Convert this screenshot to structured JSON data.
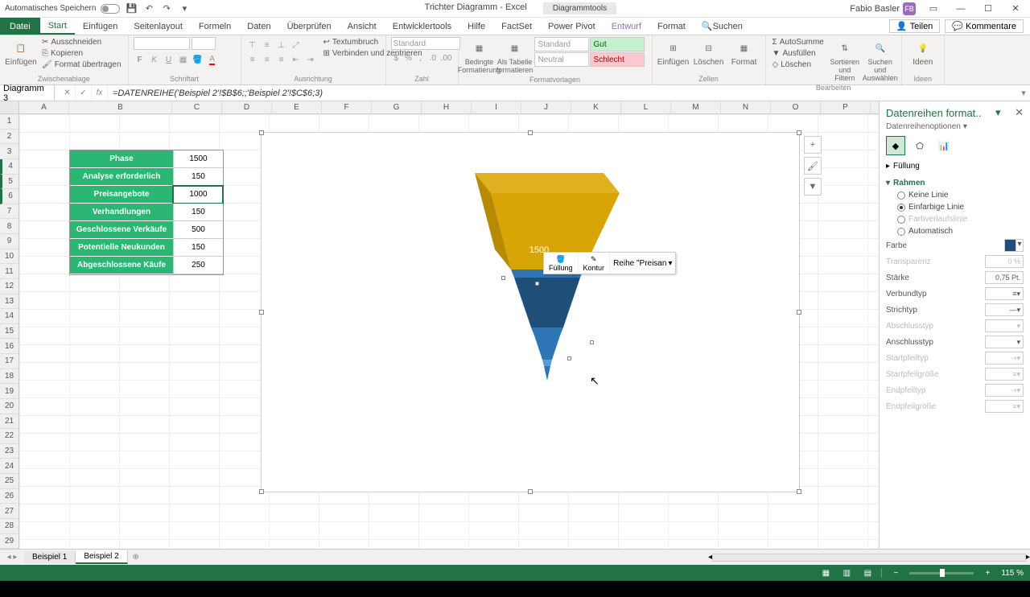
{
  "titlebar": {
    "autosave": "Automatisches Speichern",
    "center_title": "Trichter Diagramm  -  Excel",
    "tool_tab": "Diagrammtools",
    "user": "Fabio Basler",
    "user_initials": "FB"
  },
  "tabs": {
    "file": "Datei",
    "list": [
      "Start",
      "Einfügen",
      "Seitenlayout",
      "Formeln",
      "Daten",
      "Überprüfen",
      "Ansicht",
      "Entwicklertools",
      "Hilfe",
      "FactSet",
      "Power Pivot",
      "Entwurf",
      "Format"
    ],
    "search": "Suchen",
    "share": "Teilen",
    "comments": "Kommentare"
  },
  "ribbon": {
    "paste": "Einfügen",
    "cut": "Ausschneiden",
    "copy": "Kopieren",
    "format_painter": "Format übertragen",
    "clipboard": "Zwischenablage",
    "font_group": "Schriftart",
    "align_group": "Ausrichtung",
    "number_group": "Zahl",
    "wraptext": "Textumbruch",
    "merge": "Verbinden und zentrieren",
    "number_format": "Standard",
    "cond_format": "Bedingte Formatierung",
    "as_table": "Als Tabelle formatieren",
    "styles_group": "Formatvorlagen",
    "style_standard": "Standard",
    "style_good": "Gut",
    "style_neutral": "Neutral",
    "style_bad": "Schlecht",
    "insert": "Einfügen",
    "delete": "Löschen",
    "format": "Format",
    "cells_group": "Zellen",
    "autosum": "AutoSumme",
    "fill": "Ausfüllen",
    "clear": "Löschen",
    "sort": "Sortieren und Filtern",
    "find": "Suchen und Auswählen",
    "edit_group": "Bearbeiten",
    "ideas": "Ideen",
    "ideas_group": "Ideen"
  },
  "formula_bar": {
    "name": "Diagramm 3",
    "formula": "=DATENREIHE('Beispiel 2'!$B$6;;'Beispiel 2'!$C$6;3)"
  },
  "columns": [
    "A",
    "B",
    "C",
    "D",
    "E",
    "F",
    "G",
    "H",
    "I",
    "J",
    "K",
    "L",
    "M",
    "N",
    "O",
    "P"
  ],
  "rows": [
    "1",
    "2",
    "3",
    "4",
    "5",
    "6",
    "7",
    "8",
    "9",
    "10",
    "11",
    "12",
    "13",
    "14",
    "15",
    "16",
    "17",
    "18",
    "19",
    "20",
    "21",
    "22",
    "23",
    "24",
    "25",
    "26",
    "27",
    "28",
    "29"
  ],
  "table": {
    "header": "Phase",
    "header_val": "1500",
    "rows": [
      {
        "label": "Analyse erforderlich",
        "val": "150"
      },
      {
        "label": "Preisangebote",
        "val": "1000"
      },
      {
        "label": "Verhandlungen",
        "val": "150"
      },
      {
        "label": "Geschlossene Verkäufe",
        "val": "500"
      },
      {
        "label": "Potentielle Neukunden",
        "val": "150"
      },
      {
        "label": "Abgeschlossene Käufe",
        "val": "250"
      }
    ]
  },
  "chart_data": {
    "type": "funnel-3d",
    "title": "",
    "categories": [
      "Phase",
      "Analyse erforderlich",
      "Preisangebote",
      "Verhandlungen",
      "Geschlossene Verkäufe",
      "Potentielle Neukunden",
      "Abgeschlossene Käufe"
    ],
    "values": [
      1500,
      150,
      1000,
      150,
      500,
      150,
      250
    ],
    "data_labels": [
      "1500"
    ],
    "selected_series": "Preisangebote",
    "colors": {
      "top": "#d9a405",
      "selected": "#1f4e79",
      "other": "#2e75b6"
    }
  },
  "mini_toolbar": {
    "fill": "Füllung",
    "outline": "Kontur",
    "series": "Reihe \"Preisan"
  },
  "format_pane": {
    "title": "Datenreihen format..",
    "subtitle": "Datenreihenoptionen",
    "sec_fill": "Füllung",
    "sec_border": "Rahmen",
    "no_line": "Keine Linie",
    "solid_line": "Einfarbige Linie",
    "gradient": "Farbverlaufslinie",
    "auto": "Automatisch",
    "color": "Farbe",
    "transparency": "Transparenz",
    "transparency_val": "0 %",
    "width": "Stärke",
    "width_val": "0,75 Pt.",
    "compound": "Verbundtyp",
    "dash": "Strichtyp",
    "cap": "Abschlusstyp",
    "join": "Anschlusstyp",
    "arrow_begin": "Startpfeiltyp",
    "arrow_begin_size": "Startpfeilgröße",
    "arrow_end": "Endpfeiltyp",
    "arrow_end_size": "Endpfeilgröße"
  },
  "sheets": {
    "s1": "Beispiel 1",
    "s2": "Beispiel 2"
  },
  "status": {
    "zoom": "115 %"
  }
}
